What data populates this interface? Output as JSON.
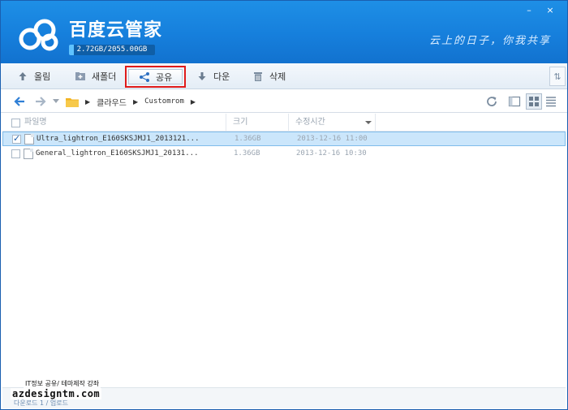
{
  "window": {
    "title": "百度云管家",
    "storage": "2.72GB/2055.00GB",
    "storage_used_fraction": 0.0013,
    "slogan": "云上的日子，你我共享",
    "controls": {
      "minimize": "–",
      "close": "×"
    }
  },
  "toolbar": {
    "upload": {
      "label": "올림",
      "icon": "upload-arrow-icon"
    },
    "new_folder": {
      "label": "새폴더",
      "icon": "new-folder-icon"
    },
    "share": {
      "label": "공유",
      "icon": "share-icon",
      "highlighted": true,
      "highlight_color": "#e01b1b"
    },
    "download": {
      "label": "다운",
      "icon": "download-arrow-icon"
    },
    "delete": {
      "label": "삭제",
      "icon": "trash-icon"
    },
    "side_toggle": "⇅"
  },
  "address": {
    "path": [
      "클라우드",
      "Customrom"
    ]
  },
  "columns": {
    "name": "파일명",
    "size": "크기",
    "modified": "수정시간"
  },
  "files": [
    {
      "name": "Ultra_lightron_E160SKSJMJ1_2013121...",
      "size": "1.36GB",
      "modified": "2013-12-16 11:00",
      "selected": true
    },
    {
      "name": "General_lightron_E160SKSJMJ1_20131...",
      "size": "1.36GB",
      "modified": "2013-12-16 10:30",
      "selected": false
    }
  ],
  "watermark": {
    "top": "IT정보 공유/ 테마제작 강좌",
    "main": "azdesigntm.com",
    "under": "다운로드 1 / 업로드"
  },
  "colors": {
    "header_blue": "#1e8fe6",
    "selection": "#cbe6fb",
    "accent": "#1a5fb0"
  }
}
